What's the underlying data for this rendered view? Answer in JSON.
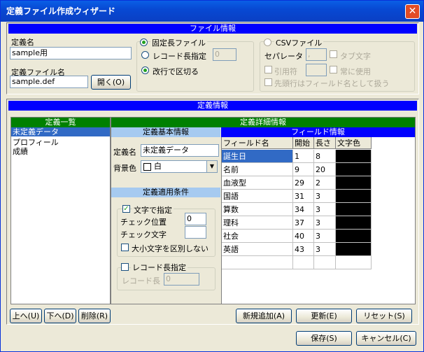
{
  "window": {
    "title": "定義ファイル作成ウィザード"
  },
  "file_section": {
    "header": "ファイル情報",
    "def_name_label": "定義名",
    "def_name_value": "sample用",
    "def_file_label": "定義ファイル名",
    "def_file_value": "sample.def",
    "open_button": "開く(O)",
    "fixed_length": "固定長ファイル",
    "record_length": "レコード長指定",
    "record_length_value": "0",
    "newline_split": "改行で区切る",
    "csv_file": "CSVファイル",
    "separator_label": "セパレータ",
    "separator_value": ",",
    "tab_char": "タブ文字",
    "quote_label": "引用符",
    "always_use": "常に使用",
    "first_row_fields": "先頭行はフィールド名として扱う"
  },
  "definition_section": {
    "header": "定義情報",
    "list_header": "定義一覧",
    "list_items": [
      "未定義データ",
      "プロフィール",
      "成績"
    ],
    "detail_header": "定義詳細情報",
    "basic_header": "定義基本情報",
    "name_label": "定義名",
    "name_value": "未定義データ",
    "bgcolor_label": "背景色",
    "bgcolor_value": "白",
    "condition_header": "定義適用条件",
    "text_spec": "文字で指定",
    "check_pos_label": "チェック位置",
    "check_pos_value": "0",
    "check_char_label": "チェック文字",
    "case_sensitive": "大小文字を区別しない",
    "record_len_spec": "レコード長指定",
    "record_len_label": "レコード長",
    "record_len_value": "0",
    "field_header": "フィールド情報",
    "columns": [
      "フィールド名",
      "開始",
      "長さ",
      "文字色"
    ],
    "rows": [
      [
        "誕生日",
        "1",
        "8"
      ],
      [
        "名前",
        "9",
        "20"
      ],
      [
        "血液型",
        "29",
        "2"
      ],
      [
        "国語",
        "31",
        "3"
      ],
      [
        "算数",
        "34",
        "3"
      ],
      [
        "理科",
        "37",
        "3"
      ],
      [
        "社会",
        "40",
        "3"
      ],
      [
        "英語",
        "43",
        "3"
      ]
    ]
  },
  "buttons": {
    "up": "上へ(U)",
    "down": "下へ(D)",
    "delete": "削除(R)",
    "add_new": "新規追加(A)",
    "update": "更新(E)",
    "reset": "リセット(S)",
    "save": "保存(S)",
    "cancel": "キャンセル(C)"
  },
  "colors": {
    "selection": "#316ac5",
    "header_blue": "#0000ff",
    "header_green": "#008000",
    "text_color_cell": "#000000"
  }
}
